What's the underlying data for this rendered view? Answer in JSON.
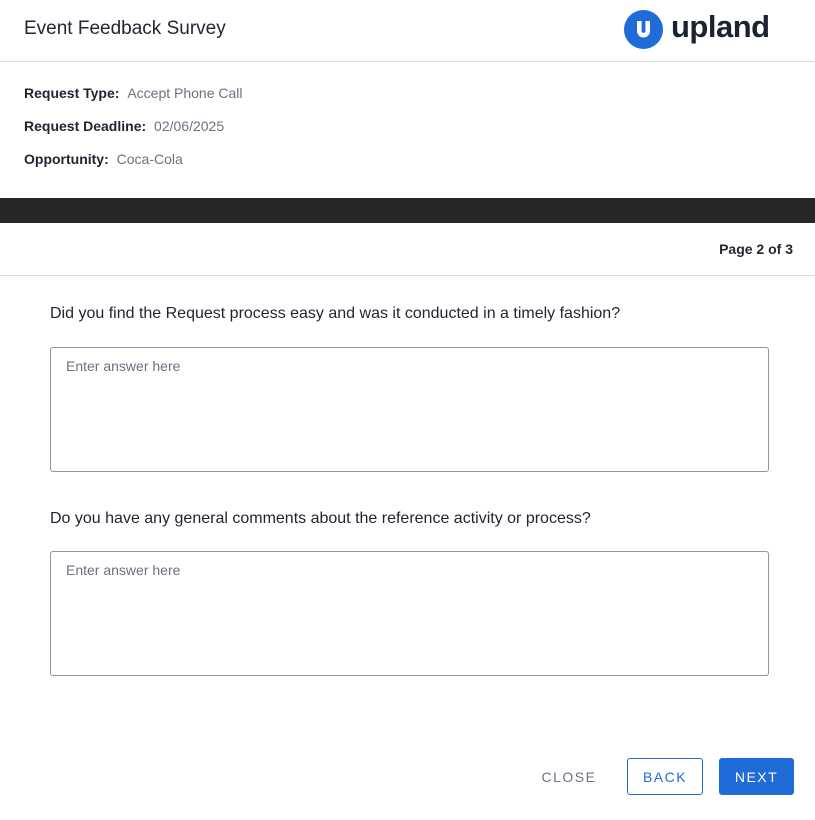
{
  "header": {
    "title": "Event Feedback Survey",
    "logo_text": "upland",
    "logo_icon": "upland-u-icon"
  },
  "info": {
    "request_type": {
      "label": "Request Type:",
      "value": "Accept Phone Call"
    },
    "request_deadline": {
      "label": "Request Deadline:",
      "value": "02/06/2025"
    },
    "opportunity": {
      "label": "Opportunity:",
      "value": "Coca-Cola"
    }
  },
  "survey": {
    "page_indicator": "Page 2 of 3",
    "questions": [
      {
        "text": "Did you find the Request process easy and was it conducted in a timely fashion?",
        "placeholder": "Enter answer here",
        "value": ""
      },
      {
        "text": "Do you have any general comments about the reference activity or process?",
        "placeholder": "Enter answer here",
        "value": ""
      }
    ]
  },
  "buttons": {
    "close": "CLOSE",
    "back": "BACK",
    "next": "NEXT"
  },
  "colors": {
    "accent": "#1f6bd8",
    "band": "#262626",
    "muted_text": "#6b7280"
  }
}
